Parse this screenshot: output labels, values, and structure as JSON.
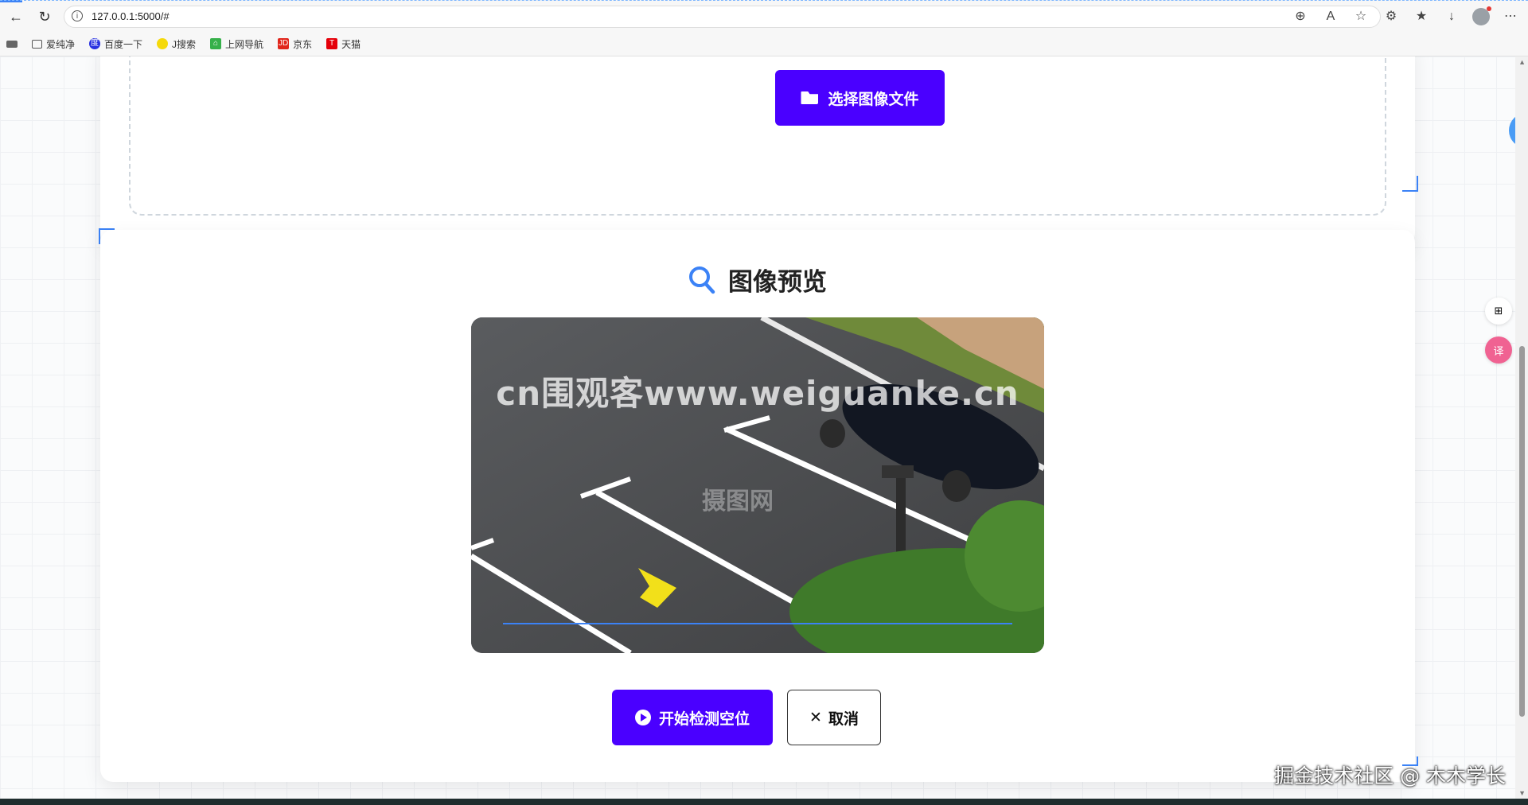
{
  "browser": {
    "url": "127.0.0.1:5000/#",
    "bookmarks": [
      {
        "label": "爱纯净",
        "icon": "folder-icon"
      },
      {
        "label": "百度一下",
        "icon": "baidu-icon"
      },
      {
        "label": "J搜索",
        "icon": "search-engine-icon"
      },
      {
        "label": "上网导航",
        "icon": "navigation-icon"
      },
      {
        "label": "京东",
        "icon": "jd-icon"
      },
      {
        "label": "天猫",
        "icon": "tmall-icon"
      }
    ]
  },
  "upload": {
    "select_button_label": "选择图像文件"
  },
  "preview": {
    "title": "图像预览",
    "image_watermark": "cn围观客www.weiguanke.cn",
    "image_watermark_center": "摄图网"
  },
  "actions": {
    "detect_label": "开始检测空位",
    "cancel_label": "取消",
    "cancel_symbol": "✕"
  },
  "overlay_credit": "掘金技术社区 @ 木木学长",
  "colors": {
    "primary": "#4a00ff",
    "accent": "#3b82f6"
  }
}
